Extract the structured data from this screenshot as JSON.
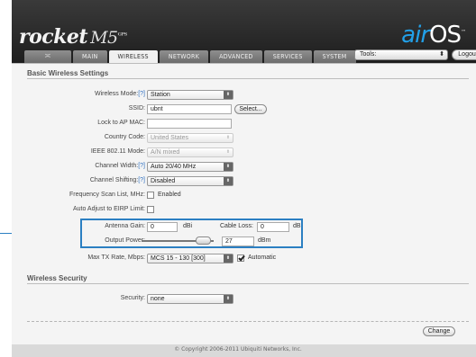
{
  "header": {
    "brand": "rocket",
    "brand_model": "M5",
    "brand_suffix": "GPS",
    "os_air": "air",
    "os_name": "OS",
    "os_tm": "™"
  },
  "tabs": {
    "logo_glyph": "≍",
    "main": "MAIN",
    "wireless": "WIRELESS",
    "network": "NETWORK",
    "advanced": "ADVANCED",
    "services": "SERVICES",
    "system": "SYSTEM"
  },
  "tools": {
    "selected": "Tools:",
    "arrow": "⬍"
  },
  "logout_label": "Logout",
  "basic": {
    "title": "Basic Wireless Settings",
    "wireless_mode": {
      "label": "Wireless Mode:",
      "help": "[?]",
      "value": "Station"
    },
    "ssid": {
      "label": "SSID:",
      "value": "ubnt",
      "button": "Select..."
    },
    "lock_ap": {
      "label": "Lock to AP MAC:",
      "value": ""
    },
    "country": {
      "label": "Country Code:",
      "value": "United States"
    },
    "ieee": {
      "label": "IEEE 802.11 Mode:",
      "value": "A/N mixed"
    },
    "width": {
      "label": "Channel Width:",
      "help": "[?]",
      "value": "Auto 20/40 MHz"
    },
    "shifting": {
      "label": "Channel Shifting:",
      "help": "[?]",
      "value": "Disabled"
    },
    "freq_scan": {
      "label": "Frequency Scan List, MHz:",
      "checkbox_label": "Enabled",
      "checked": false
    },
    "eirp": {
      "label": "Auto Adjust to EIRP Limit:",
      "checked": false
    },
    "antenna_gain": {
      "label": "Antenna Gain:",
      "value": "0",
      "unit": "dBi"
    },
    "cable_loss": {
      "label": "Cable Loss:",
      "value": "0",
      "unit": "dB"
    },
    "output_power": {
      "label": "Output Power:",
      "value": "27",
      "unit": "dBm",
      "level_fraction": 0.85
    },
    "max_tx": {
      "label": "Max TX Rate, Mbps:",
      "value": "MCS 15 - 130 [300]",
      "checkbox_label": "Automatic",
      "checked": true
    }
  },
  "security": {
    "title": "Wireless Security",
    "label": "Security:",
    "value": "none"
  },
  "change_label": "Change",
  "footer": "© Copyright 2006-2011 Ubiquiti Networks, Inc.",
  "colors": {
    "highlight": "#2b7fc2",
    "header_bg": "#2a2a2a",
    "airos_accent": "#22a0e8",
    "help_link": "#2f6fc0"
  }
}
